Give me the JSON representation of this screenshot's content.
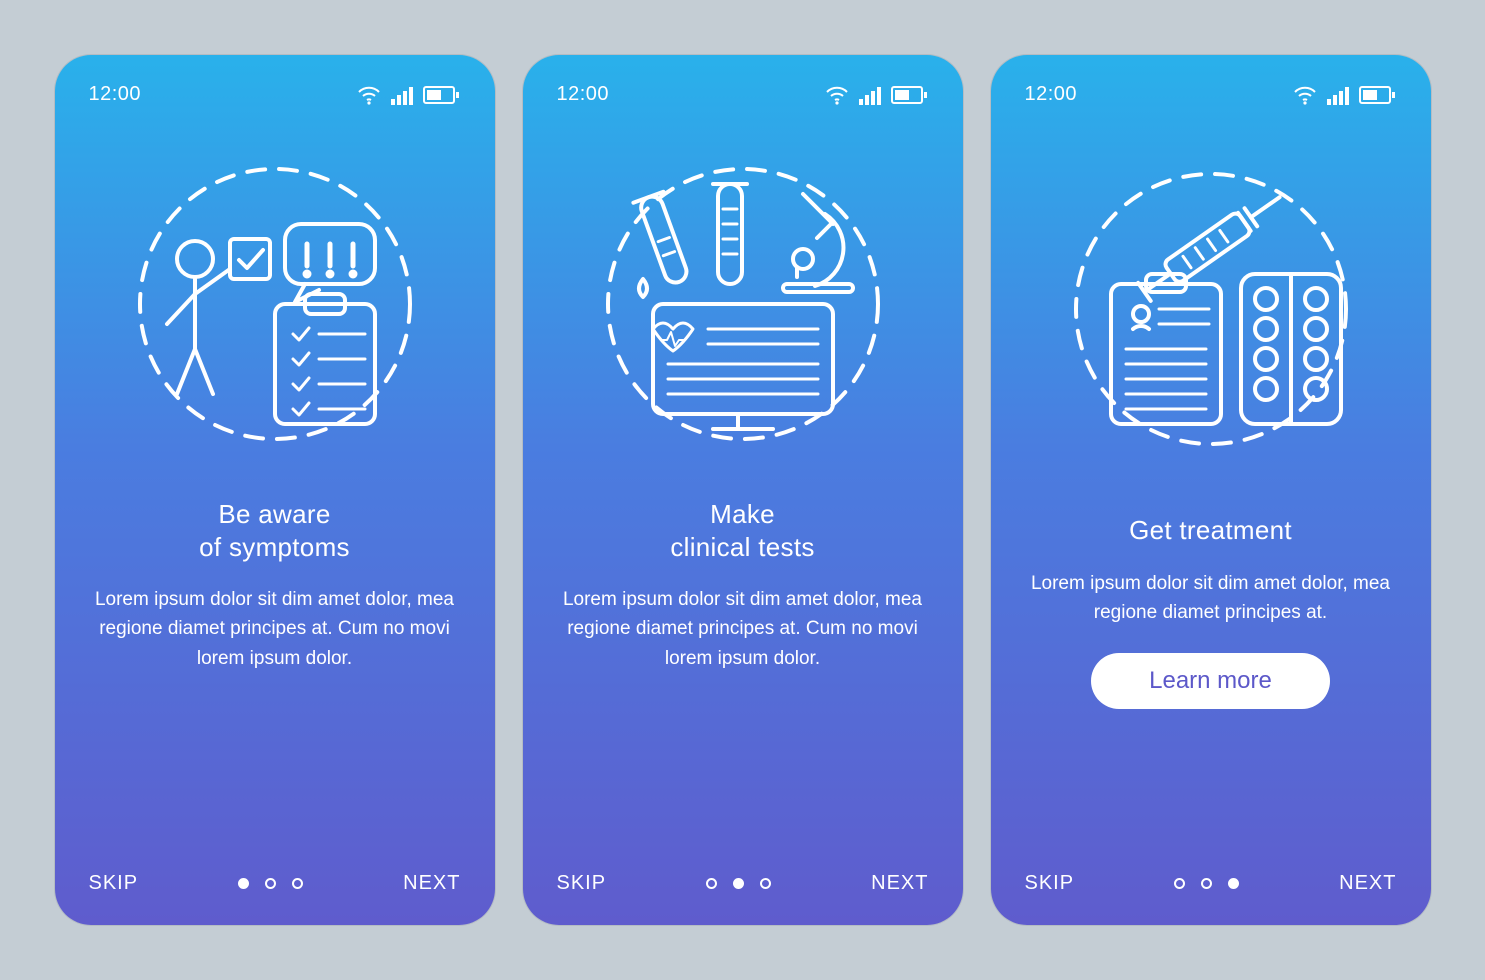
{
  "status": {
    "time": "12:00"
  },
  "nav": {
    "skip": "SKIP",
    "next": "NEXT"
  },
  "cta_label": "Learn more",
  "screens": [
    {
      "title": "Be aware\nof symptoms",
      "body": "Lorem ipsum dolor sit dim amet dolor, mea regione diamet principes at. Cum no movi lorem ipsum dolor.",
      "page_index": 0,
      "has_cta": false,
      "icon": "symptoms"
    },
    {
      "title": "Make\nclinical tests",
      "body": "Lorem ipsum dolor sit dim amet dolor, mea regione diamet principes at. Cum no movi lorem ipsum dolor.",
      "page_index": 1,
      "has_cta": false,
      "icon": "tests"
    },
    {
      "title": "Get treatment",
      "body": "Lorem ipsum dolor sit dim amet dolor, mea regione diamet principes at.",
      "page_index": 2,
      "has_cta": true,
      "icon": "treatment"
    }
  ],
  "colors": {
    "gradient_top": "#29b1eb",
    "gradient_bottom": "#5f5ccd",
    "page_bg": "#c4cdd4",
    "cta_text": "#5c58c9"
  }
}
